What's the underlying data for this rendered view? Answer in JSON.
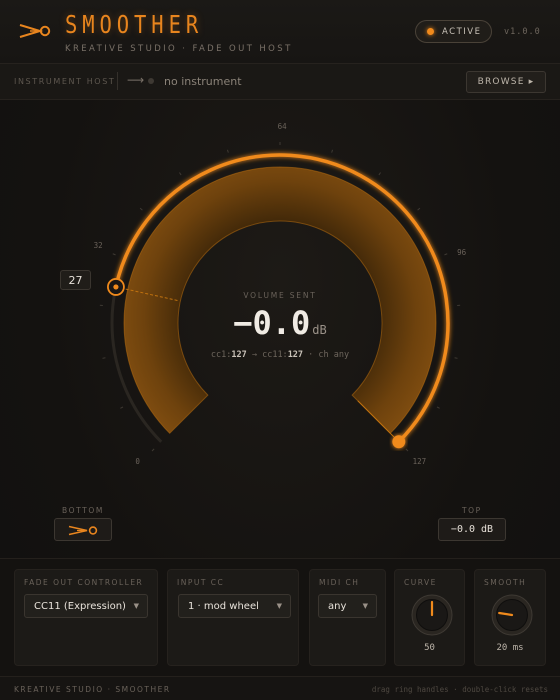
{
  "header": {
    "title": "SMOOTHER",
    "subtitle": "KREATIVE STUDIO · FADE OUT HOST",
    "active_label": "ACTIVE",
    "version": "v1.0.0",
    "logo_icon": "fader-scissors-icon",
    "accent_color": "#f08a1c"
  },
  "host": {
    "label": "INSTRUMENT HOST",
    "arrow": "⟶",
    "instrument": "no instrument",
    "browse_label": "BROWSE ▸"
  },
  "dial": {
    "scale": [
      "0",
      "32",
      "64",
      "96",
      "127"
    ],
    "bottom_value": "27",
    "top_value_cc": 127,
    "volume_label": "VOLUME SENT",
    "volume_value": "−0.0",
    "volume_unit": "dB",
    "cc_text_prefix": "cc1:",
    "cc1": "127",
    "cc_arrow": " → cc11:",
    "cc11": "127",
    "cc_suffix": " · ch any",
    "bottom_label": "BOTTOM",
    "top_label": "TOP",
    "top_value": "−0.0 dB"
  },
  "controls": {
    "fade_out_controller": {
      "label": "FADE OUT CONTROLLER",
      "value": "CC11 (Expression)"
    },
    "input_cc": {
      "label": "INPUT CC",
      "value": "1 · mod wheel"
    },
    "midi_ch": {
      "label": "MIDI CH",
      "value": "any"
    },
    "curve": {
      "label": "CURVE",
      "value": "50",
      "level": 0.5
    },
    "smooth": {
      "label": "SMOOTH",
      "value": "20 ms",
      "level": 0.2
    }
  },
  "footer": {
    "left": "KREATIVE STUDIO · SMOOTHER",
    "right": "drag ring handles · double-click resets"
  }
}
